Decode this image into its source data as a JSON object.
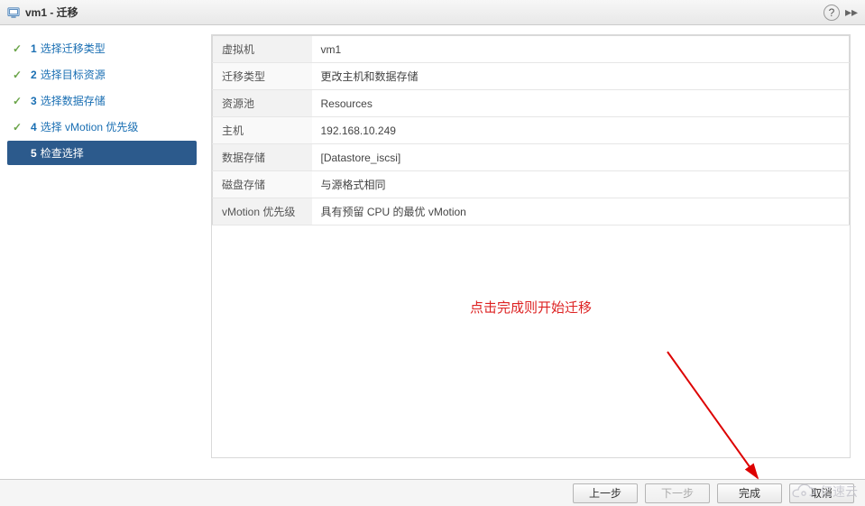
{
  "title": "vm1 - 迁移",
  "sidebar": {
    "steps": [
      {
        "num": "1",
        "label": "选择迁移类型",
        "completed": true
      },
      {
        "num": "2",
        "label": "选择目标资源",
        "completed": true
      },
      {
        "num": "3",
        "label": "选择数据存储",
        "completed": true
      },
      {
        "num": "4",
        "label": "选择 vMotion 优先级",
        "completed": true
      },
      {
        "num": "5",
        "label": "检查选择",
        "active": true
      }
    ]
  },
  "summary": {
    "rows": [
      {
        "label": "虚拟机",
        "value": "vm1"
      },
      {
        "label": "迁移类型",
        "value": "更改主机和数据存储"
      },
      {
        "label": "资源池",
        "value": "Resources"
      },
      {
        "label": "主机",
        "value": "192.168.10.249"
      },
      {
        "label": "数据存储",
        "value": "[Datastore_iscsi]"
      },
      {
        "label": "磁盘存储",
        "value": "与源格式相同"
      },
      {
        "label": "vMotion 优先级",
        "value": "具有预留 CPU 的最优 vMotion"
      }
    ]
  },
  "note_text": "点击完成则开始迁移",
  "footer": {
    "back_label": "上一步",
    "next_label": "下一步",
    "finish_label": "完成",
    "cancel_label": "取消"
  },
  "watermark_text": "亿速云"
}
